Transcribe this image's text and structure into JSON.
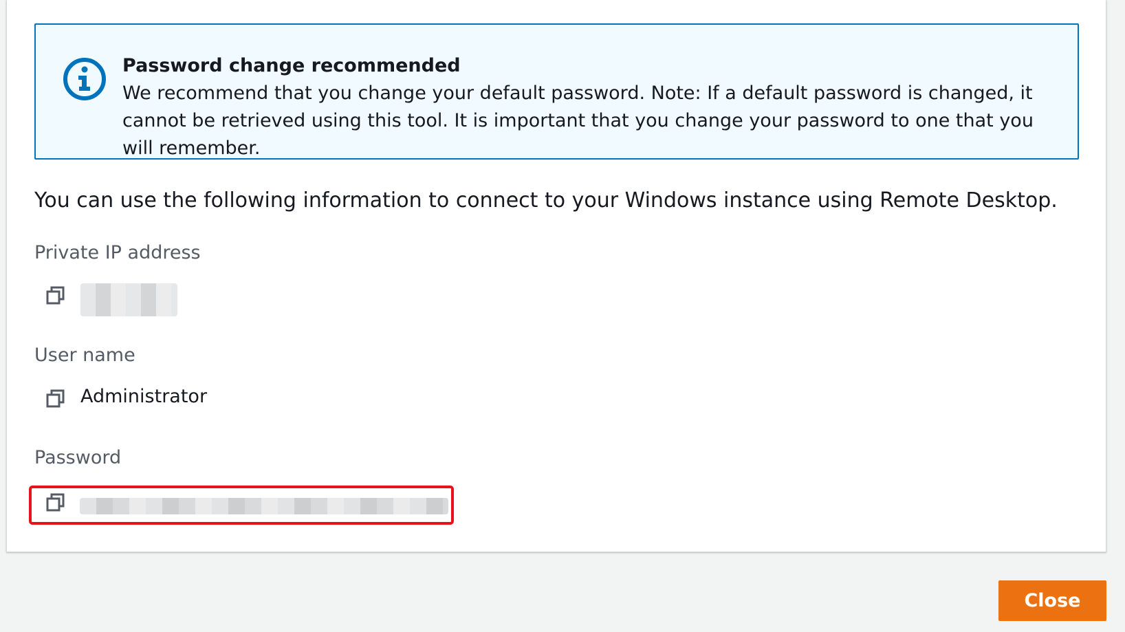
{
  "alert": {
    "icon": "info-circle-icon",
    "title": "Password change recommended",
    "body": "We recommend that you change your default password. Note: If a default password is changed, it cannot be retrieved using this tool. It is important that you change your password to one that you will remember."
  },
  "intro": "You can use the following information to connect to your Windows instance using Remote Desktop.",
  "fields": {
    "private_ip": {
      "label": "Private IP address",
      "value_state": "redacted"
    },
    "user_name": {
      "label": "User name",
      "value": "Administrator"
    },
    "password": {
      "label": "Password",
      "value_state": "redacted"
    }
  },
  "copy_icon": "copy-icon",
  "footer": {
    "close_label": "Close"
  },
  "colors": {
    "accent": "#0073bb",
    "alert_bg": "#f1faff",
    "primary_button": "#ec7211",
    "highlight": "#e8121a"
  }
}
